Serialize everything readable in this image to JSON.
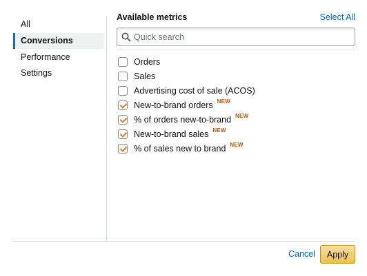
{
  "nav": {
    "items": [
      {
        "label": "All",
        "active": false
      },
      {
        "label": "Conversions",
        "active": true
      },
      {
        "label": "Performance",
        "active": false
      },
      {
        "label": "Settings",
        "active": false
      }
    ]
  },
  "main": {
    "title": "Available metrics",
    "select_all": "Select All",
    "search": {
      "placeholder": "Quick search",
      "value": ""
    },
    "metrics": [
      {
        "label": "Orders",
        "checked": false,
        "badge": ""
      },
      {
        "label": "Sales",
        "checked": false,
        "badge": ""
      },
      {
        "label": "Advertising cost of sale (ACOS)",
        "checked": false,
        "badge": ""
      },
      {
        "label": "New-to-brand orders",
        "checked": true,
        "badge": "NEW"
      },
      {
        "label": "% of orders new-to-brand",
        "checked": true,
        "badge": "NEW"
      },
      {
        "label": "New-to-brand sales",
        "checked": true,
        "badge": "NEW"
      },
      {
        "label": "% of sales new to brand",
        "checked": true,
        "badge": "NEW"
      }
    ]
  },
  "footer": {
    "cancel": "Cancel",
    "apply": "Apply"
  },
  "colors": {
    "accent_link": "#0066c0",
    "check": "#e47911",
    "badge": "#c45500",
    "apply_button": "#f0c14b",
    "active_nav_border": "#146eb4"
  }
}
